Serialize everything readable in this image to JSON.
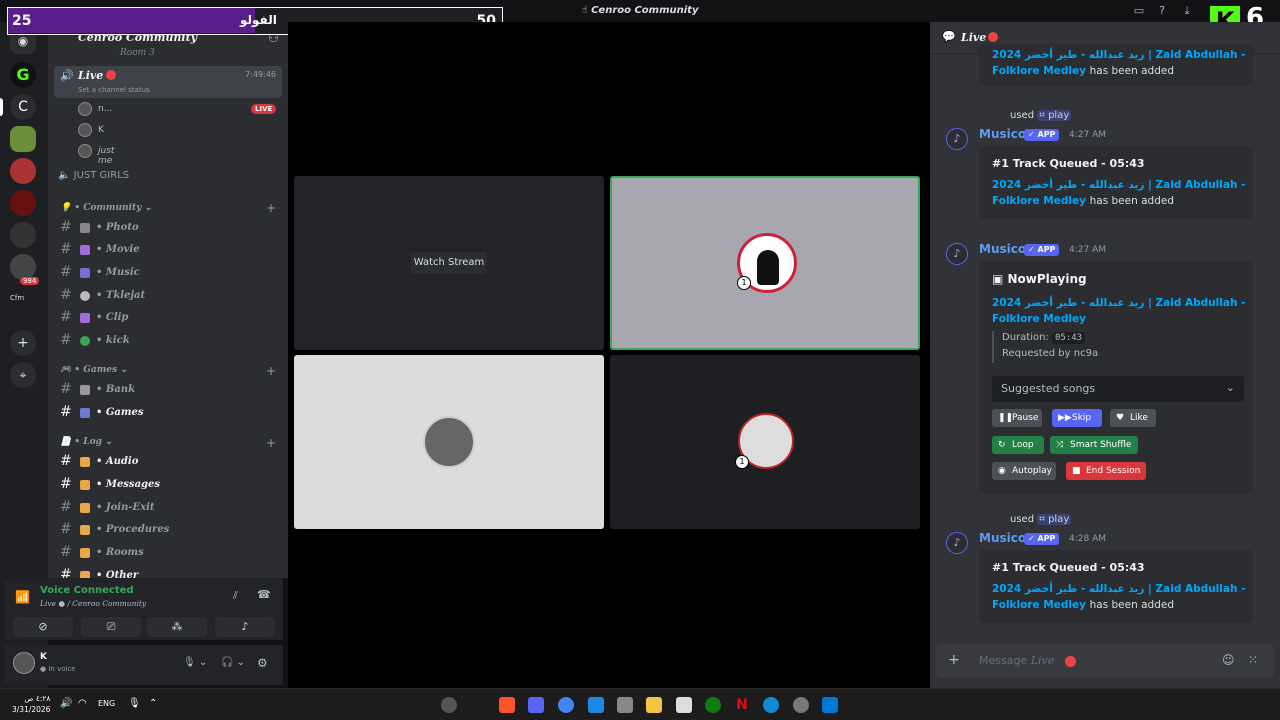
{
  "window": {
    "title": "Cenroo Community"
  },
  "overlay": {
    "left_value": "25",
    "center_text": "الفولو",
    "right_value": "50",
    "progress": 0.5
  },
  "kick_overlay": {
    "letter": "K",
    "count": "6"
  },
  "server_list": {
    "badges": [
      "984"
    ],
    "label": "Cfm"
  },
  "channels": {
    "server_name": "Cenroo Community",
    "top_partial": "Room 3",
    "live_channel": {
      "name": "Live",
      "time": "7:49:46",
      "status": "Set a channel status"
    },
    "voice_users": [
      {
        "name": "n...",
        "live": "LIVE"
      },
      {
        "name": "K"
      },
      {
        "name": "just me"
      }
    ],
    "just_girls": "JUST GIRLS",
    "community_cat": "Community",
    "community_items": [
      "Photo",
      "Movie",
      "Music",
      "Tklejat",
      "Clip",
      "kick"
    ],
    "games_cat": "Games",
    "games_items": [
      "Bank",
      "Games"
    ],
    "log_cat": "Log",
    "log_items": [
      "Audio",
      "Messages",
      "Join-Exit",
      "Procedures",
      "Rooms",
      "Other"
    ]
  },
  "voice_panel": {
    "status": "Voice Connected",
    "channel": "Live",
    "server": "Cenroo Community"
  },
  "user_panel": {
    "name": "K",
    "status": "In voice"
  },
  "stage": {
    "watch_label": "Watch Stream",
    "badge_num": "1"
  },
  "chat": {
    "header": "Live",
    "top_line1": "2024 زيد عبدالله - طير أخضر | Zaid Abdullah -",
    "top_line2": "Folklore Medley",
    "has_been_added": "has been added",
    "used": "used",
    "cmd": "play",
    "author": "Musico",
    "app": "APP",
    "ts1": "4:27 AM",
    "ts2": "4:27 AM",
    "ts3": "4:28 AM",
    "queued_title": "#1 Track Queued - 05:43",
    "track_line1": "2024 زيد عبدالله - طير أخضر | Zaid Abdullah -",
    "track_line2": "Folklore Medley",
    "np_title": "NowPlaying",
    "duration_label": "Duration:",
    "duration": "05:43",
    "requested": "Requested by nc9a",
    "suggested": "Suggested songs",
    "buttons": {
      "pause": "Pause",
      "skip": "Skip",
      "like": "Like",
      "loop": "Loop",
      "shuffle": "Smart Shuffle",
      "autoplay": "Autoplay",
      "end": "End Session"
    },
    "input_placeholder": "Message",
    "input_channel": "Live"
  },
  "taskbar": {
    "time": "٤:٢٨ ص",
    "date": "3/31/2026",
    "lang": "ENG"
  }
}
